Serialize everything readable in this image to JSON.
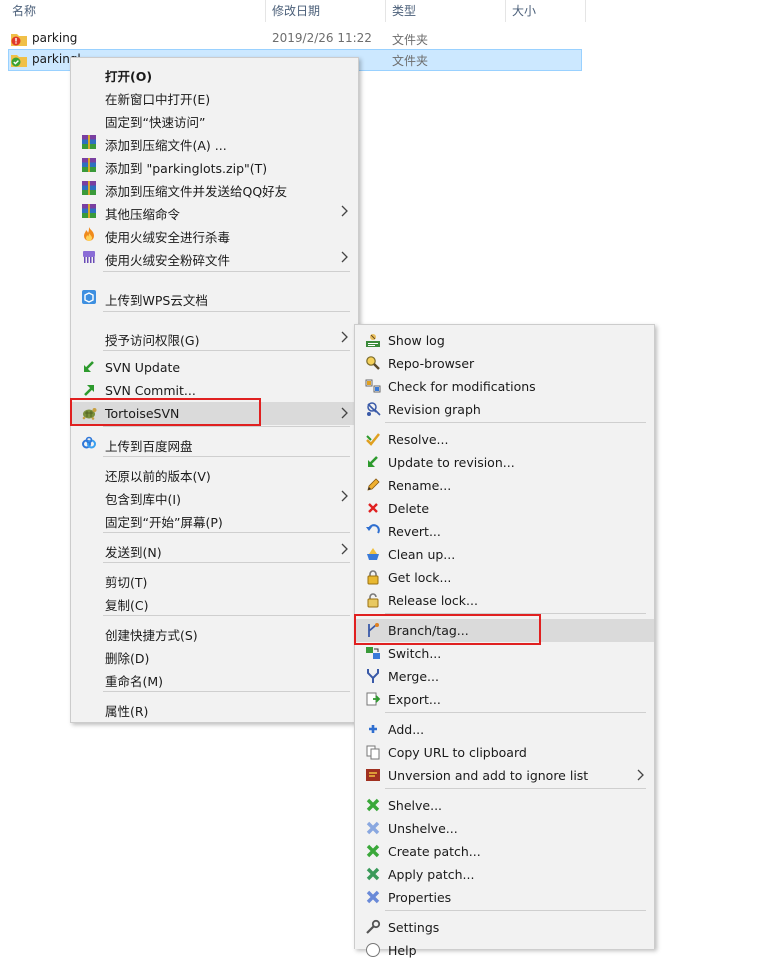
{
  "columns": {
    "name": "名称",
    "date": "修改日期",
    "type": "类型",
    "size": "大小"
  },
  "files": [
    {
      "name": "parking",
      "date": "2019/2/26 11:22",
      "type": "文件夹",
      "status": "warning"
    },
    {
      "name": "parkingl",
      "date": "",
      "type": "文件夹",
      "status": "ok"
    }
  ],
  "main_menu": [
    {
      "label": "打开(O)",
      "bold": true
    },
    {
      "label": "在新窗口中打开(E)"
    },
    {
      "label": "固定到“快速访问”"
    },
    {
      "label": "添加到压缩文件(A) ...",
      "icon": "winrar-icon"
    },
    {
      "label": "添加到 \"parkinglots.zip\"(T)",
      "icon": "winrar-icon"
    },
    {
      "label": "添加到压缩文件并发送给QQ好友",
      "icon": "winrar-icon"
    },
    {
      "label": "其他压缩命令",
      "icon": "winrar-icon",
      "submenu": true
    },
    {
      "label": "使用火绒安全进行杀毒",
      "icon": "huorong-icon"
    },
    {
      "label": "使用火绒安全粉碎文件",
      "icon": "shredder-icon",
      "submenu": true
    },
    {
      "label": "上传到WPS云文档",
      "icon": "wps-cloud-icon"
    },
    {
      "label": "授予访问权限(G)",
      "submenu": true
    },
    {
      "label": "SVN Update",
      "icon": "svn-update-icon"
    },
    {
      "label": "SVN Commit...",
      "icon": "svn-commit-icon"
    },
    {
      "label": "TortoiseSVN",
      "icon": "tortoise-icon",
      "submenu": true
    },
    {
      "label": "上传到百度网盘",
      "icon": "baidu-cloud-icon"
    },
    {
      "label": "还原以前的版本(V)"
    },
    {
      "label": "包含到库中(I)",
      "submenu": true
    },
    {
      "label": "固定到“开始”屏幕(P)"
    },
    {
      "label": "发送到(N)",
      "submenu": true
    },
    {
      "label": "剪切(T)"
    },
    {
      "label": "复制(C)"
    },
    {
      "label": "创建快捷方式(S)"
    },
    {
      "label": "删除(D)"
    },
    {
      "label": "重命名(M)"
    },
    {
      "label": "属性(R)"
    }
  ],
  "svn_menu": [
    {
      "label": "Show log",
      "icon": "log-icon"
    },
    {
      "label": "Repo-browser",
      "icon": "repo-browser-icon"
    },
    {
      "label": "Check for modifications",
      "icon": "check-modifications-icon"
    },
    {
      "label": "Revision graph",
      "icon": "revision-graph-icon"
    },
    {
      "label": "Resolve...",
      "icon": "resolve-icon"
    },
    {
      "label": "Update to revision...",
      "icon": "update-revision-icon"
    },
    {
      "label": "Rename...",
      "icon": "pencil-icon"
    },
    {
      "label": "Delete",
      "icon": "delete-x-icon"
    },
    {
      "label": "Revert...",
      "icon": "revert-icon"
    },
    {
      "label": "Clean up...",
      "icon": "cleanup-icon"
    },
    {
      "label": "Get lock...",
      "icon": "lock-icon"
    },
    {
      "label": "Release lock...",
      "icon": "unlock-icon"
    },
    {
      "label": "Branch/tag...",
      "icon": "branch-icon"
    },
    {
      "label": "Switch...",
      "icon": "switch-icon"
    },
    {
      "label": "Merge...",
      "icon": "merge-icon"
    },
    {
      "label": "Export...",
      "icon": "export-icon"
    },
    {
      "label": "Add...",
      "icon": "add-icon"
    },
    {
      "label": "Copy URL to clipboard",
      "icon": "copy-url-icon"
    },
    {
      "label": "Unversion and add to ignore list",
      "icon": "ignore-icon",
      "submenu": true
    },
    {
      "label": "Shelve...",
      "icon": "shelve-icon"
    },
    {
      "label": "Unshelve...",
      "icon": "unshelve-icon"
    },
    {
      "label": "Create patch...",
      "icon": "create-patch-icon"
    },
    {
      "label": "Apply patch...",
      "icon": "apply-patch-icon"
    },
    {
      "label": "Properties",
      "icon": "properties-icon"
    },
    {
      "label": "Settings",
      "icon": "settings-icon"
    },
    {
      "label": "Help",
      "icon": "help-icon"
    }
  ],
  "colors": {
    "highlight": "#e02020",
    "selection": "#cce8ff",
    "menu_bg": "#f2f2f2"
  }
}
